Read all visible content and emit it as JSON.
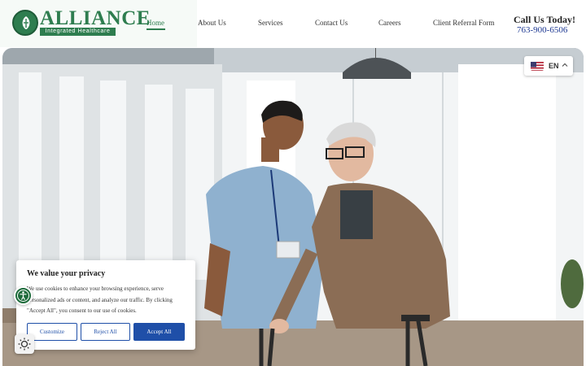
{
  "header": {
    "logo_title": "ALLIANCE",
    "logo_subtitle": "Integrated Healthcare",
    "nav": [
      "Home",
      "About Us",
      "Services",
      "Contact Us",
      "Careers",
      "Client Referral Form"
    ],
    "active_nav": "Home",
    "call_title": "Call Us Today!",
    "call_phone": "763-900-6506"
  },
  "language": {
    "code": "EN",
    "flag_icon": "us-flag-icon",
    "chevron_icon": "chevron-up-icon"
  },
  "cookie": {
    "title": "We value your privacy",
    "text": "We use cookies to enhance your browsing experience, serve personalized ads or content, and analyze our traffic. By clicking \"Accept All\", you consent to our use of cookies.",
    "customize": "Customize",
    "reject": "Reject All",
    "accept": "Accept All"
  },
  "widgets": {
    "accessibility_icon": "accessibility-icon",
    "theme_icon": "sun-icon"
  },
  "colors": {
    "brand_green": "#2e7d4f",
    "button_blue": "#1f4fa8",
    "phone_blue": "#1f3a93"
  }
}
